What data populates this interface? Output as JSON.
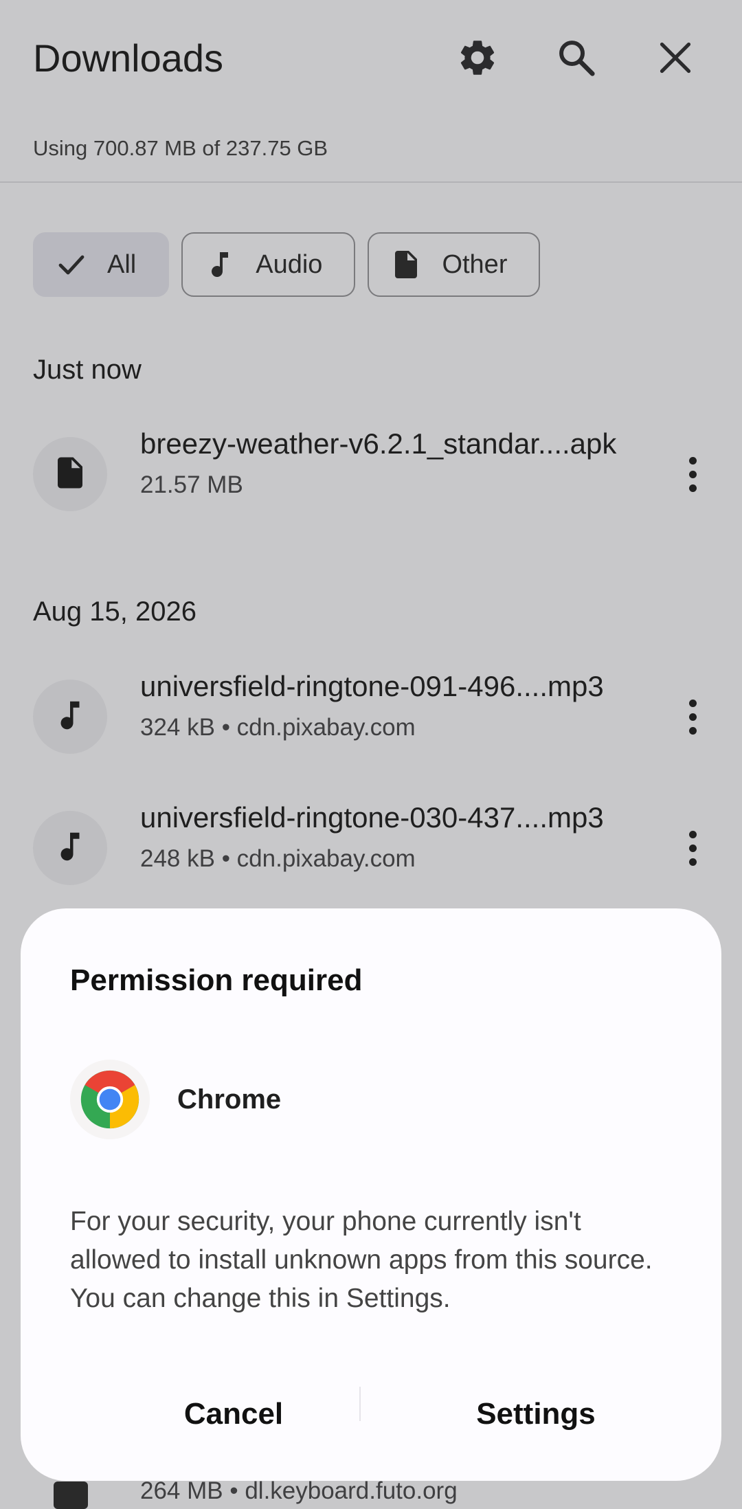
{
  "header": {
    "title": "Downloads",
    "storage_text": "Using 700.87 MB of 237.75 GB",
    "icons": [
      "settings-icon",
      "search-icon",
      "close-icon"
    ]
  },
  "filters": [
    {
      "label": "All",
      "icon": "check-icon",
      "selected": true
    },
    {
      "label": "Audio",
      "icon": "music-note-icon",
      "selected": false
    },
    {
      "label": "Other",
      "icon": "document-icon",
      "selected": false
    }
  ],
  "sections": [
    {
      "label": "Just now",
      "items": [
        {
          "name": "breezy-weather-v6.2.1_standar....apk",
          "meta": "21.57 MB",
          "icon": "document-icon"
        }
      ]
    },
    {
      "label": "Aug 15, 2026",
      "items": [
        {
          "name": "universfield-ringtone-091-496....mp3",
          "meta": "324 kB • cdn.pixabay.com",
          "icon": "music-note-icon"
        },
        {
          "name": "universfield-ringtone-030-437....mp3",
          "meta": "248 kB • cdn.pixabay.com",
          "icon": "music-note-icon"
        }
      ]
    }
  ],
  "peek_item": {
    "meta": "264 MB • dl.keyboard.futo.org"
  },
  "dialog": {
    "title": "Permission required",
    "app_name": "Chrome",
    "app_icon": "chrome-logo-icon",
    "message": "For your security, your phone currently isn't allowed to install unknown apps from this source. You can change this in Settings.",
    "cancel_label": "Cancel",
    "settings_label": "Settings"
  },
  "colors": {
    "background_dimmed": "#c8c8ca",
    "dialog_surface": "#fdfcff",
    "chip_selected": "#b8b8bf"
  }
}
